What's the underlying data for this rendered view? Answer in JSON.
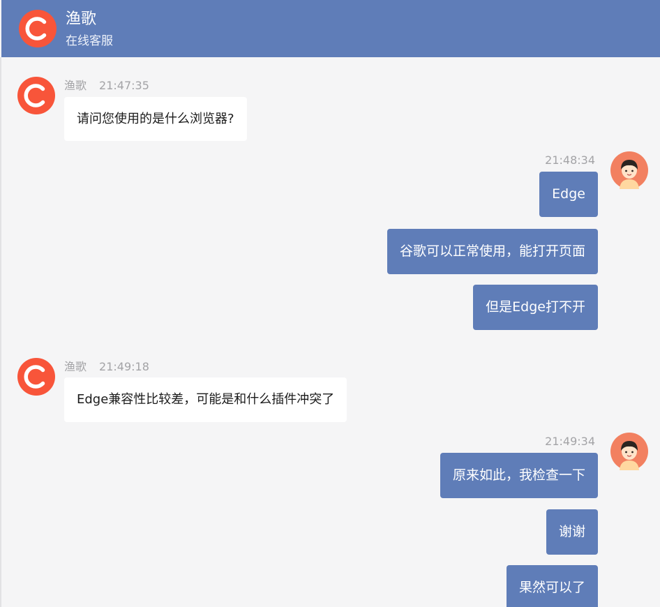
{
  "header": {
    "name": "渔歌",
    "status": "在线客服",
    "avatar_letter": "C"
  },
  "colors": {
    "header_bg": "#5f7db8",
    "agent_avatar": "#f8553a",
    "user_avatar_bg": "#f28060",
    "own_bubble": "#5f7db8",
    "agent_bubble": "#ffffff",
    "page_bg": "#f5f5f6"
  },
  "messages": {
    "m1": {
      "sender": "渔歌",
      "time": "21:47:35",
      "text": "请问您使用的是什么浏览器?",
      "avatar_letter": "C"
    },
    "g1": {
      "time": "21:48:34",
      "lines": [
        "Edge",
        "谷歌可以正常使用，能打开页面",
        "但是Edge打不开"
      ]
    },
    "m2": {
      "sender": "渔歌",
      "time": "21:49:18",
      "text": "Edge兼容性比较差，可能是和什么插件冲突了",
      "avatar_letter": "C"
    },
    "g2": {
      "time": "21:49:34",
      "lines": [
        "原来如此，我检查一下",
        "谢谢",
        "果然可以了"
      ]
    }
  }
}
